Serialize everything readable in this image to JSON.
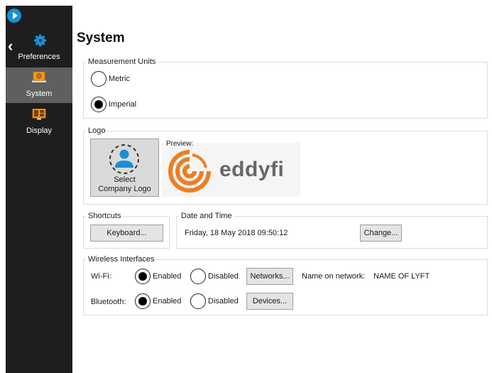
{
  "sidebar": {
    "back_icon": "chevron-left-icon",
    "preferences_label": "Preferences",
    "items": [
      {
        "label": "System",
        "icon": "system-icon",
        "active": true
      },
      {
        "label": "Display",
        "icon": "display-icon",
        "active": false
      }
    ]
  },
  "page": {
    "title": "System"
  },
  "measurement_units": {
    "legend": "Measurement Units",
    "options": [
      {
        "label": "Metric",
        "checked": false
      },
      {
        "label": "Imperial",
        "checked": true
      }
    ]
  },
  "logo": {
    "legend": "Logo",
    "select_line1": "Select",
    "select_line2": "Company Logo",
    "preview_label": "Preview:",
    "preview_brand": "eddyfi"
  },
  "shortcuts": {
    "legend": "Shortcuts",
    "keyboard_button": "Keyboard..."
  },
  "datetime": {
    "legend": "Date and Time",
    "value": "Friday, 18 May 2018 09:50:12",
    "change_button": "Change..."
  },
  "wireless": {
    "legend": "Wireless Interfaces",
    "wifi": {
      "label": "Wi-Fi:",
      "enabled_label": "Enabled",
      "disabled_label": "Disabled",
      "enabled": true,
      "button": "Networks...",
      "name_label": "Name on network:",
      "name_value": "NAME OF LYFT"
    },
    "bluetooth": {
      "label": "Bluetooth:",
      "enabled_label": "Enabled",
      "disabled_label": "Disabled",
      "enabled": true,
      "button": "Devices..."
    }
  },
  "colors": {
    "sidebar_bg": "#1e1e1e",
    "sidebar_active": "#5f5f5f",
    "accent_blue": "#1b8fd6",
    "icon_orange": "#f39b1e",
    "brand_orange": "#ef7d22",
    "brand_gray": "#666666"
  }
}
